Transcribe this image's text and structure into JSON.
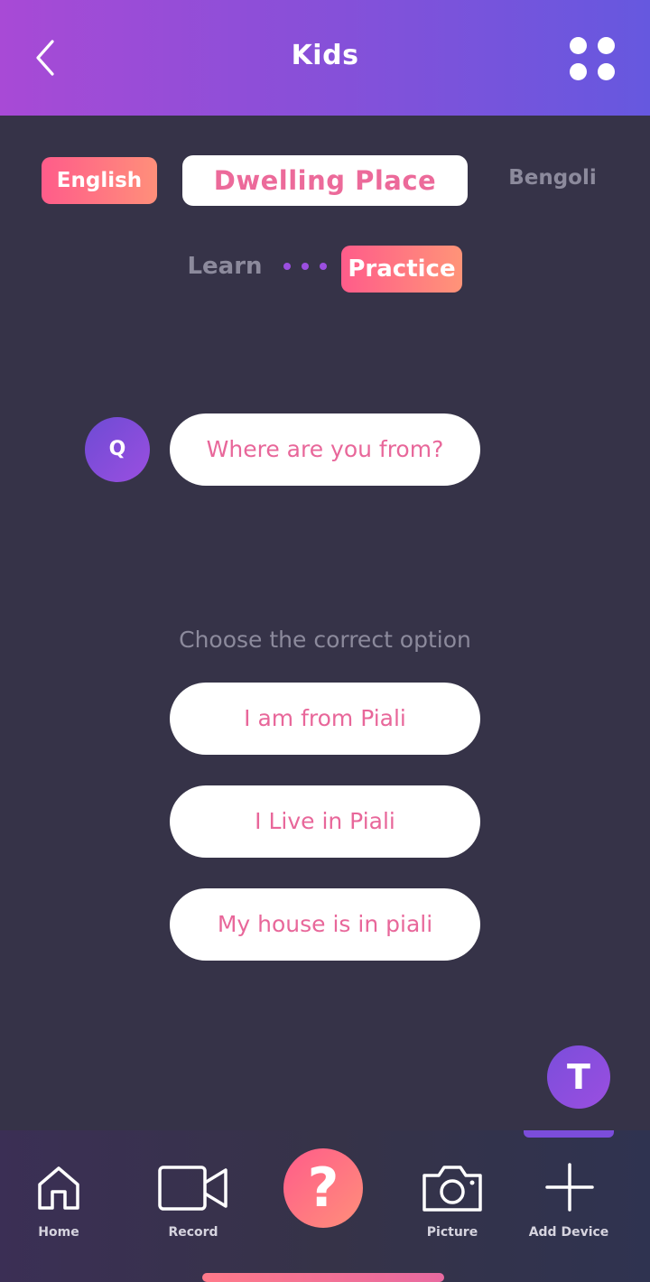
{
  "header": {
    "title": "Kids",
    "back_icon": "chevron-left-icon",
    "menu_icon": "four-dots-grid-icon"
  },
  "languages": {
    "source": "English",
    "topic": "Dwelling Place",
    "target": "Bengoli"
  },
  "modes": {
    "learn": "Learn",
    "practice": "Practice",
    "active": "Practice"
  },
  "question": {
    "avatar_letter": "Q",
    "text": "Where are you from?"
  },
  "instruction": "Choose the correct option",
  "options": [
    "I am from Piali",
    "I Live in Piali",
    "My house is in piali"
  ],
  "floating_avatar": "T",
  "bottom_nav": {
    "items": [
      {
        "label": "Home",
        "icon": "home-icon"
      },
      {
        "label": "Record",
        "icon": "video-camera-icon"
      },
      {
        "label": "?",
        "icon": "help-icon"
      },
      {
        "label": "Picture",
        "icon": "camera-icon"
      },
      {
        "label": "Add Device",
        "icon": "plus-icon"
      }
    ],
    "active": "Add Device"
  },
  "colors": {
    "background": "#363348",
    "header_gradient_start": "#a84ad6",
    "header_gradient_end": "#6658df",
    "accent_pink": "#e8679a",
    "accent_gradient_start": "#ff5c8a",
    "accent_gradient_end": "#ff8f7a",
    "purple": "#9a4fe0",
    "muted_text": "#8c8a9c"
  }
}
